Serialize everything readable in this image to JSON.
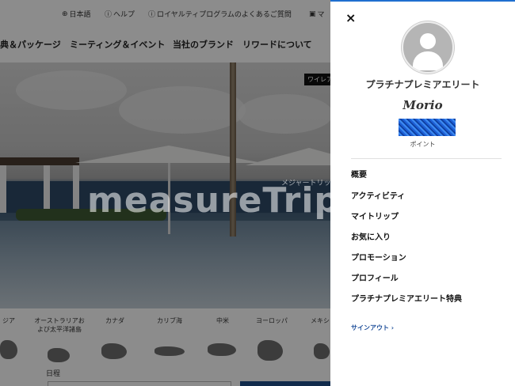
{
  "topbar": {
    "language": "日本語",
    "help": "ヘルプ",
    "loyalty_faq": "ロイヤルティプログラムのよくあるご質問",
    "my_page": "マ"
  },
  "nav": {
    "items": [
      "典＆パッケージ",
      "ミーティング＆イベント",
      "当社のブランド",
      "リワードについて"
    ]
  },
  "hero": {
    "badge": "ワイレア"
  },
  "regions": {
    "items": [
      {
        "label": "ジア"
      },
      {
        "label": "オーストラリアおよび太平洋諸島"
      },
      {
        "label": "カナダ"
      },
      {
        "label": "カリブ海"
      },
      {
        "label": "中米"
      },
      {
        "label": "ヨーロッパ"
      },
      {
        "label": "メキシ"
      }
    ],
    "date_label": "日程"
  },
  "watermark": {
    "text": "measureTrip",
    "sub": "メジャートリップ"
  },
  "panel": {
    "close_symbol": "×",
    "tier": "プラチナプレミアエリート",
    "username": "Morio",
    "points_label": "ポイント",
    "menu": [
      "概要",
      "アクティビティ",
      "マイトリップ",
      "お気に入り",
      "プロモーション",
      "プロフィール",
      "プラチナプレミアエリート特典"
    ],
    "signout": "サインアウト ›",
    "colors": {
      "accent": "#1f6fd0",
      "link": "#1f4f9a"
    }
  },
  "icons": {
    "language": "globe-icon",
    "help": "question-icon",
    "info": "info-icon",
    "bag": "bag-icon"
  }
}
